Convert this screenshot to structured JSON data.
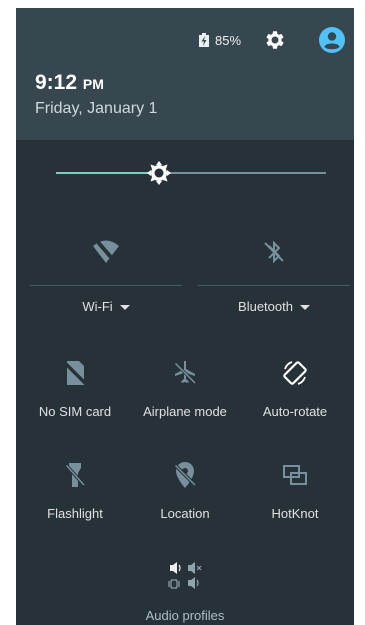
{
  "status": {
    "battery_text": "85%"
  },
  "header": {
    "time": "9:12",
    "ampm": "PM",
    "date": "Friday, January 1"
  },
  "brightness": {
    "level": 0.38
  },
  "wide_tiles": [
    {
      "id": "wifi",
      "label": "Wi-Fi",
      "icon": "wifi-off-icon"
    },
    {
      "id": "bluetooth",
      "label": "Bluetooth",
      "icon": "bluetooth-off-icon"
    }
  ],
  "tiles": [
    {
      "id": "sim",
      "label": "No SIM card",
      "icon": "no-sim-icon"
    },
    {
      "id": "airplane",
      "label": "Airplane mode",
      "icon": "airplane-icon"
    },
    {
      "id": "rotate",
      "label": "Auto-rotate",
      "icon": "auto-rotate-icon"
    },
    {
      "id": "flashlight",
      "label": "Flashlight",
      "icon": "flashlight-icon"
    },
    {
      "id": "location",
      "label": "Location",
      "icon": "location-off-icon"
    },
    {
      "id": "hotknot",
      "label": "HotKnot",
      "icon": "hotknot-icon"
    }
  ],
  "audio": {
    "label": "Audio profiles",
    "icon": "audio-profiles-icon"
  },
  "colors": {
    "panel_bg": "#263238",
    "header_bg": "#37474f",
    "accent": "#80cbc4",
    "profile": "#4fc3f7"
  }
}
